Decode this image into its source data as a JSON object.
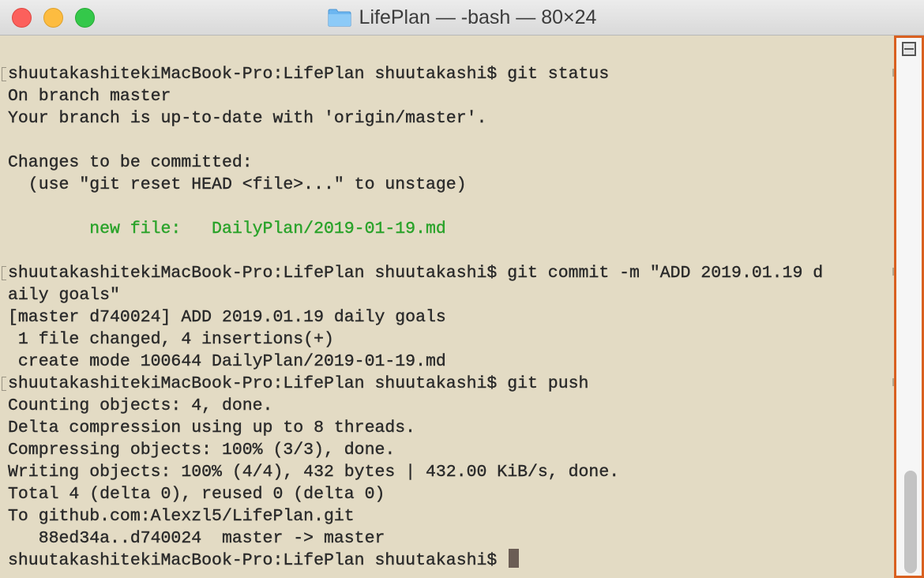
{
  "window": {
    "title": "LifePlan — -bash — 80×24",
    "title_icon": "folder-icon"
  },
  "colors": {
    "background": "#e3dbc4",
    "text": "#2b2b2b",
    "green": "#2aa32a",
    "cursor": "#6b5d55",
    "scrollbar_highlight": "#d96020"
  },
  "terminal": {
    "lines": [
      "shuutakashitekiMacBook-Pro:LifePlan shuutakashi$ git status",
      "On branch master",
      "Your branch is up-to-date with 'origin/master'.",
      "",
      "Changes to be committed:",
      "  (use \"git reset HEAD <file>...\" to unstage)",
      "",
      "        new file:   DailyPlan/2019-01-19.md",
      "",
      "shuutakashitekiMacBook-Pro:LifePlan shuutakashi$ git commit -m \"ADD 2019.01.19 d",
      "aily goals\"",
      "[master d740024] ADD 2019.01.19 daily goals",
      " 1 file changed, 4 insertions(+)",
      " create mode 100644 DailyPlan/2019-01-19.md",
      "shuutakashitekiMacBook-Pro:LifePlan shuutakashi$ git push",
      "Counting objects: 4, done.",
      "Delta compression using up to 8 threads.",
      "Compressing objects: 100% (3/3), done.",
      "Writing objects: 100% (4/4), 432 bytes | 432.00 KiB/s, done.",
      "Total 4 (delta 0), reused 0 (delta 0)",
      "To github.com:Alexzl5/LifePlan.git",
      "   88ed34a..d740024  master -> master"
    ],
    "prompt": "shuutakashitekiMacBook-Pro:LifePlan shuutakashi$ "
  }
}
